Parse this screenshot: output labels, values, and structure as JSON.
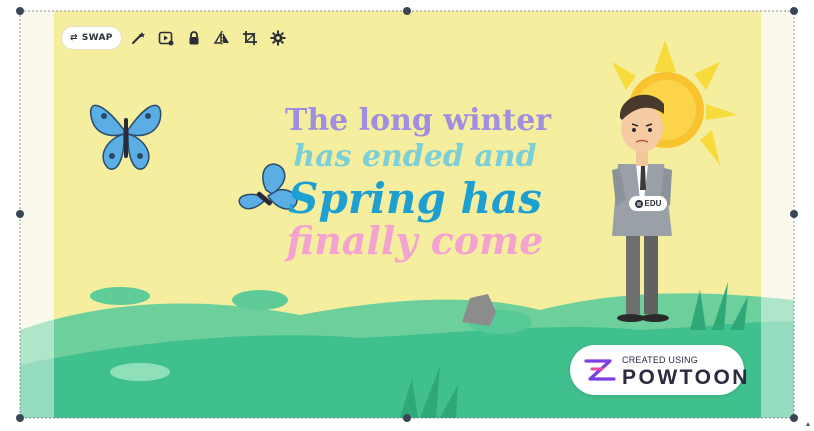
{
  "toolbar": {
    "swap_label": "SWAP",
    "icons": [
      "swap-arrows-icon",
      "magic-wand-icon",
      "animation-play-icon",
      "lock-icon",
      "flip-icon",
      "crop-icon",
      "settings-gear-icon"
    ]
  },
  "scene": {
    "headline": {
      "line1": "The long winter",
      "line2": "has ended and",
      "line3": "Spring has",
      "line4": "finally come"
    },
    "edu_badge": "EDU",
    "watermark": {
      "small_text": "CREATED USING",
      "brand_text": "POWTOON"
    }
  },
  "colors": {
    "sky": "#f5ee9e",
    "grass": "#3fc08c",
    "headline_line1": "#a08ee0",
    "headline_line2": "#7ccfd6",
    "headline_line3": "#1e9fd2",
    "headline_line4": "#f3a3cf",
    "selection_handle": "#3a4656"
  }
}
